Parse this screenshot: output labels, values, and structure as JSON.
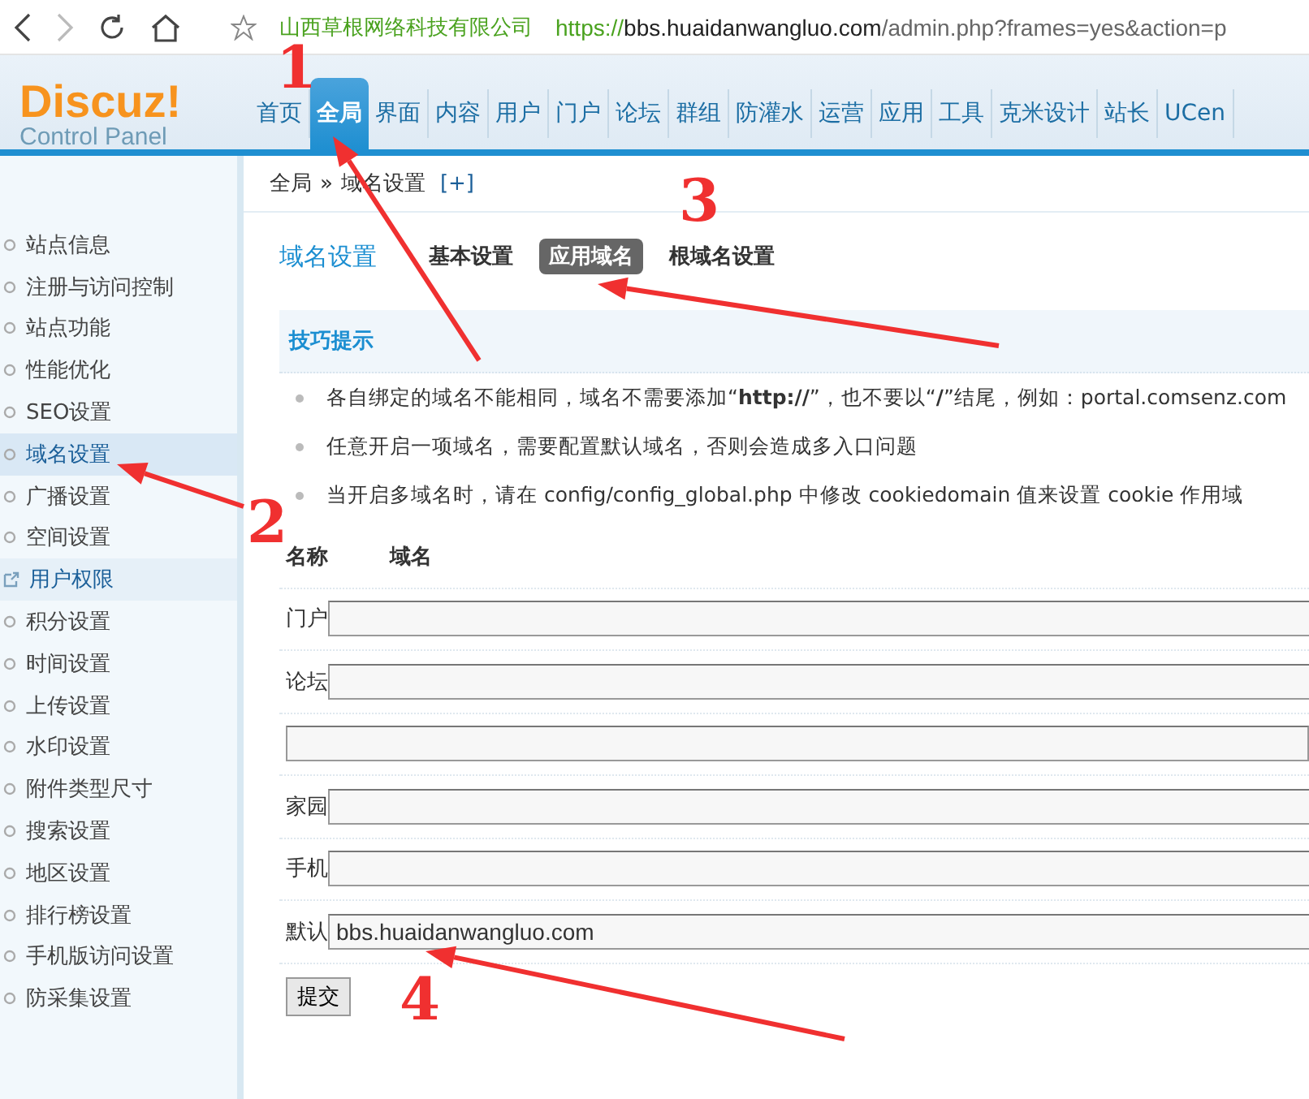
{
  "browser": {
    "site_name": "山西草根网络科技有限公司",
    "url_scheme": "https://",
    "url_host": "bbs.huaidanwangluo.com",
    "url_path": "/admin.php?frames=yes&action=p"
  },
  "logo": {
    "title": "Discuz!",
    "subtitle": "Control Panel"
  },
  "nav": [
    {
      "label": "首页",
      "selected": false
    },
    {
      "label": "全局",
      "selected": true
    },
    {
      "label": "界面",
      "selected": false
    },
    {
      "label": "内容",
      "selected": false
    },
    {
      "label": "用户",
      "selected": false
    },
    {
      "label": "门户",
      "selected": false
    },
    {
      "label": "论坛",
      "selected": false
    },
    {
      "label": "群组",
      "selected": false
    },
    {
      "label": "防灌水",
      "selected": false
    },
    {
      "label": "运营",
      "selected": false
    },
    {
      "label": "应用",
      "selected": false
    },
    {
      "label": "工具",
      "selected": false
    },
    {
      "label": "克米设计",
      "selected": false
    },
    {
      "label": "站长",
      "selected": false
    },
    {
      "label": "UCen",
      "selected": false
    }
  ],
  "breadcrumb": {
    "parent": "全局",
    "separator": "»",
    "current": "域名设置",
    "add": "[+]"
  },
  "sidebar": {
    "items": [
      {
        "label": "站点信息",
        "kind": "page",
        "selected": false
      },
      {
        "label": "注册与访问控制",
        "kind": "page",
        "selected": false
      },
      {
        "label": "站点功能",
        "kind": "page",
        "selected": false
      },
      {
        "label": "性能优化",
        "kind": "page",
        "selected": false
      },
      {
        "label": "SEO设置",
        "kind": "page",
        "selected": false
      },
      {
        "label": "域名设置",
        "kind": "page",
        "selected": true
      },
      {
        "label": "广播设置",
        "kind": "page",
        "selected": false
      },
      {
        "label": "空间设置",
        "kind": "page",
        "selected": false
      },
      {
        "label": "用户权限",
        "kind": "external",
        "selected": false
      },
      {
        "label": "积分设置",
        "kind": "page",
        "selected": false
      },
      {
        "label": "时间设置",
        "kind": "page",
        "selected": false
      },
      {
        "label": "上传设置",
        "kind": "page",
        "selected": false
      },
      {
        "label": "水印设置",
        "kind": "page",
        "selected": false
      },
      {
        "label": "附件类型尺寸",
        "kind": "page",
        "selected": false
      },
      {
        "label": "搜索设置",
        "kind": "page",
        "selected": false
      },
      {
        "label": "地区设置",
        "kind": "page",
        "selected": false
      },
      {
        "label": "排行榜设置",
        "kind": "page",
        "selected": false
      },
      {
        "label": "手机版访问设置",
        "kind": "page",
        "selected": false
      },
      {
        "label": "防采集设置",
        "kind": "page",
        "selected": false
      }
    ]
  },
  "page": {
    "title": "域名设置",
    "tabs": [
      {
        "label": "基本设置",
        "selected": false
      },
      {
        "label": "应用域名",
        "selected": true
      },
      {
        "label": "根域名设置",
        "selected": false
      }
    ]
  },
  "tips": {
    "title": "技巧提示",
    "items": [
      "各自绑定的域名不能相同，域名不需要添加“**http://**”，也不要以“**/**”结尾，例如：portal.comsenz.com",
      "任意开启一项域名，需要配置默认域名，否则会造成多入口问题",
      "当开启多域名时，请在 config/config_global.php 中修改 cookiedomain 值来设置 cookie 作用域"
    ]
  },
  "table": {
    "columns": [
      "名称",
      "域名"
    ],
    "rows": [
      {
        "name": "门户"
      },
      {
        "name": "论坛"
      },
      {},
      {
        "name": "家园"
      },
      {
        "name": "手机"
      },
      {
        "name": "默认",
        "value": "bbs.huaidanwangluo.com"
      }
    ]
  },
  "submit": "提交",
  "annotations": [
    {
      "label": "1"
    },
    {
      "label": "2"
    },
    {
      "label": "3"
    },
    {
      "label": "4"
    }
  ]
}
